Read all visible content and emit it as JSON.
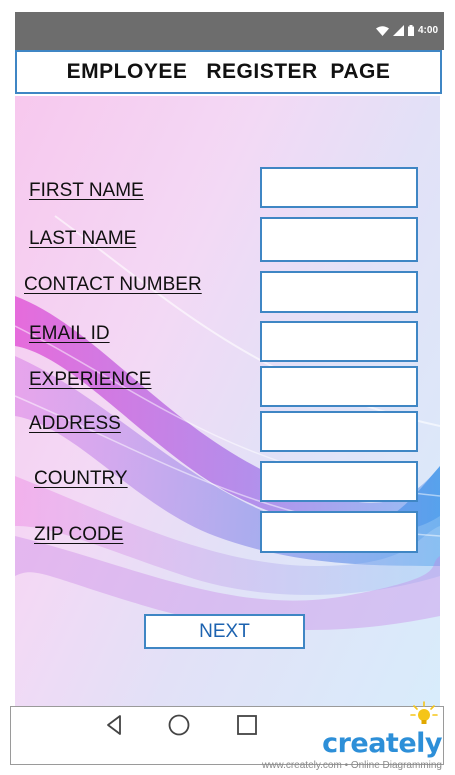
{
  "status_bar": {
    "time": "4:00"
  },
  "header": {
    "title": "EMPLOYEE   REGISTER  PAGE"
  },
  "form": {
    "fields": [
      {
        "label": "FIRST NAME",
        "value": ""
      },
      {
        "label": "LAST NAME",
        "value": ""
      },
      {
        "label": "CONTACT NUMBER",
        "value": ""
      },
      {
        "label": "EMAIL ID",
        "value": ""
      },
      {
        "label": "EXPERIENCE",
        "value": ""
      },
      {
        "label": "ADDRESS",
        "value": ""
      },
      {
        "label": "COUNTRY",
        "value": ""
      },
      {
        "label": "ZIP CODE",
        "value": ""
      }
    ],
    "next_label": "NEXT"
  },
  "nav_bar": {
    "icons": [
      "back-triangle-icon",
      "home-circle-icon",
      "recents-square-icon"
    ]
  },
  "watermark": {
    "logo": "creately",
    "tagline": "www.creately.com • Online Diagramming"
  },
  "colors": {
    "border": "#3f86c4",
    "button_text": "#1d63b0",
    "status_bar": "#6d6d6d",
    "brand": "#2d8fd8"
  }
}
